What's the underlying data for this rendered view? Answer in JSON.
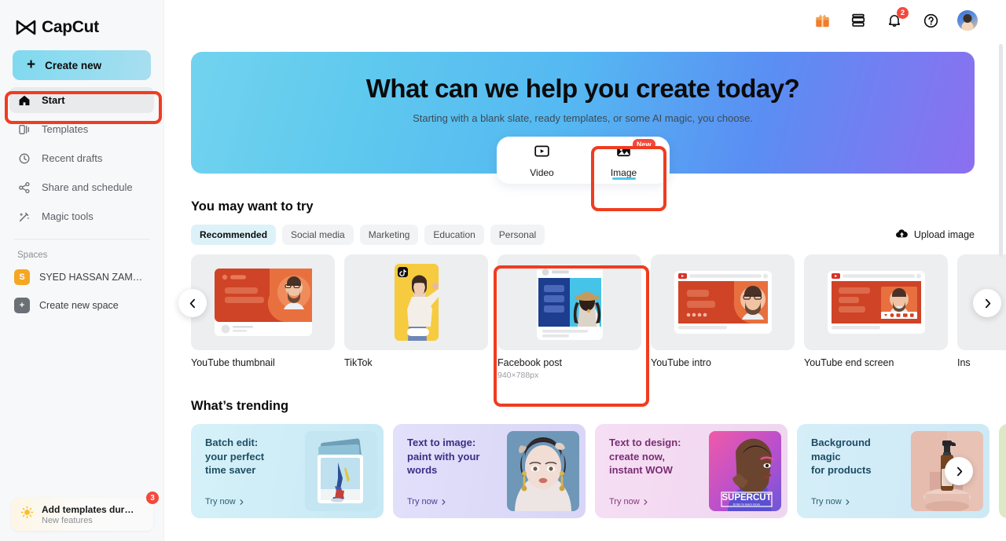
{
  "brand": {
    "name": "CapCut",
    "accent": "#53c7ec",
    "danger": "#f5483b",
    "annotation": "#f03c20"
  },
  "sidebar": {
    "create_new_label": "Create new",
    "nav": [
      {
        "label": "Start",
        "icon": "home-icon",
        "active": true
      },
      {
        "label": "Templates",
        "icon": "templates-icon",
        "active": false
      },
      {
        "label": "Recent drafts",
        "icon": "clock-icon",
        "active": false
      },
      {
        "label": "Share and schedule",
        "icon": "share-icon",
        "active": false
      },
      {
        "label": "Magic tools",
        "icon": "magic-wand-icon",
        "active": false
      }
    ],
    "spaces_label": "Spaces",
    "spaces": [
      {
        "initial": "S",
        "name": "SYED HASSAN ZAM…",
        "color": "#f5a623"
      },
      {
        "initial": "+",
        "name": "Create new space",
        "color": "#6b7077"
      }
    ],
    "promo": {
      "title": "Add templates durin…",
      "subtitle": "New features",
      "badge": "3",
      "icon": "lightbulb-icon"
    }
  },
  "topbar": {
    "icons": [
      {
        "name": "gift-icon",
        "badge": null
      },
      {
        "name": "archive-box-icon",
        "badge": null
      },
      {
        "name": "bell-icon",
        "badge": "2"
      },
      {
        "name": "help-circle-icon",
        "badge": null
      }
    ],
    "avatar_name": "user-avatar"
  },
  "hero": {
    "title": "What can we help you create today?",
    "subtitle": "Starting with a blank slate, ready templates, or some AI magic, you choose.",
    "gradient_from": "#72d3ef",
    "gradient_to": "#8c6ff0",
    "modes": [
      {
        "label": "Video",
        "icon": "video-icon",
        "active": false,
        "badge": null
      },
      {
        "label": "Image",
        "icon": "image-icon",
        "active": true,
        "badge": "New"
      }
    ]
  },
  "try_section": {
    "title": "You may want to try",
    "chips": [
      {
        "label": "Recommended",
        "active": true
      },
      {
        "label": "Social media",
        "active": false
      },
      {
        "label": "Marketing",
        "active": false
      },
      {
        "label": "Education",
        "active": false
      },
      {
        "label": "Personal",
        "active": false
      }
    ],
    "upload_label": "Upload image",
    "upload_icon": "upload-cloud-icon",
    "prev_icon": "chevron-left-icon",
    "next_icon": "chevron-right-icon",
    "cards": [
      {
        "name": "YouTube thumbnail",
        "dimensions": "",
        "art": "yt-thumb",
        "selected": false
      },
      {
        "name": "TikTok",
        "dimensions": "",
        "art": "tiktok",
        "selected": false
      },
      {
        "name": "Facebook post",
        "dimensions": "940×788px",
        "art": "fb-post",
        "selected": true
      },
      {
        "name": "YouTube intro",
        "dimensions": "",
        "art": "yt-intro",
        "selected": false
      },
      {
        "name": "YouTube end screen",
        "dimensions": "",
        "art": "yt-end",
        "selected": false
      },
      {
        "name": "Ins",
        "dimensions": "",
        "art": "instagram",
        "selected": false
      }
    ]
  },
  "trending_section": {
    "title": "What’s trending",
    "next_icon": "chevron-right-icon",
    "cards": [
      {
        "title": "Batch edit:\nyour perfect\ntime saver",
        "cta": "Try now",
        "bg_from": "#d4f0f8",
        "bg_to": "#c8ecf6",
        "text_color": "#1f4f63",
        "art": "shoes"
      },
      {
        "title": "Text to image:\npaint with your\nwords",
        "cta": "Try now",
        "bg_from": "#dedcf8",
        "bg_to": "#d9d6f7",
        "text_color": "#3b2f86",
        "art": "portrait"
      },
      {
        "title": "Text to design:\ncreate now,\ninstant WOW",
        "cta": "Try now",
        "bg_from": "#f4dcf2",
        "bg_to": "#f0d9f0",
        "text_color": "#7a2d72",
        "art": "supercut"
      },
      {
        "title": "Background\nmagic\nfor products",
        "cta": "Try now",
        "bg_from": "#d2ecf6",
        "bg_to": "#cfeaf5",
        "text_color": "#1c4c63",
        "art": "bottle"
      },
      {
        "title": "",
        "cta": "",
        "bg_from": "#dde8c4",
        "bg_to": "#dde8c4",
        "text_color": "#3d4a22",
        "art": "none"
      }
    ]
  },
  "annotations": [
    {
      "name": "start-nav-highlight"
    },
    {
      "name": "image-mode-highlight"
    },
    {
      "name": "facebook-post-card-highlight"
    }
  ]
}
